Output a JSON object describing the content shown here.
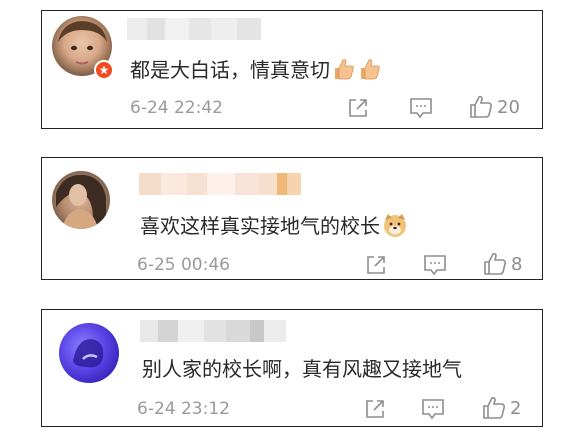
{
  "comments": [
    {
      "text": "都是大白话，情真意切",
      "emojis": [
        "thumbs-up-emoji",
        "thumbs-up-emoji"
      ],
      "timestamp": "6-24 22:42",
      "likes": "20",
      "badge": "vip-badge",
      "accent": "#f04a1e"
    },
    {
      "text": "喜欢这样真实接地气的校长",
      "emojis": [
        "doge-emoji"
      ],
      "timestamp": "6-25 00:46",
      "likes": "8"
    },
    {
      "text": "别人家的校长啊，真有风趣又接地气",
      "emojis": [],
      "timestamp": "6-24 23:12",
      "likes": "2"
    }
  ],
  "actions": [
    "share-icon",
    "comment-icon",
    "like-icon"
  ]
}
